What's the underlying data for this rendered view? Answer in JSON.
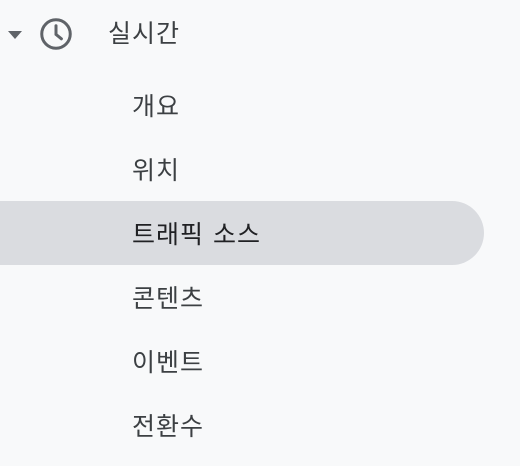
{
  "section": {
    "title": "실시간",
    "expanded": true,
    "icon": "clock-icon",
    "caret_icon": "caret-down-icon"
  },
  "items": [
    {
      "label": "개요",
      "active": false
    },
    {
      "label": "위치",
      "active": false
    },
    {
      "label": "트래픽 소스",
      "active": true
    },
    {
      "label": "콘텐츠",
      "active": false
    },
    {
      "label": "이벤트",
      "active": false
    },
    {
      "label": "전환수",
      "active": false
    }
  ],
  "colors": {
    "background": "#f8f9fa",
    "active_background": "#dadce0",
    "text": "#3c4043",
    "icon": "#5f6368"
  }
}
